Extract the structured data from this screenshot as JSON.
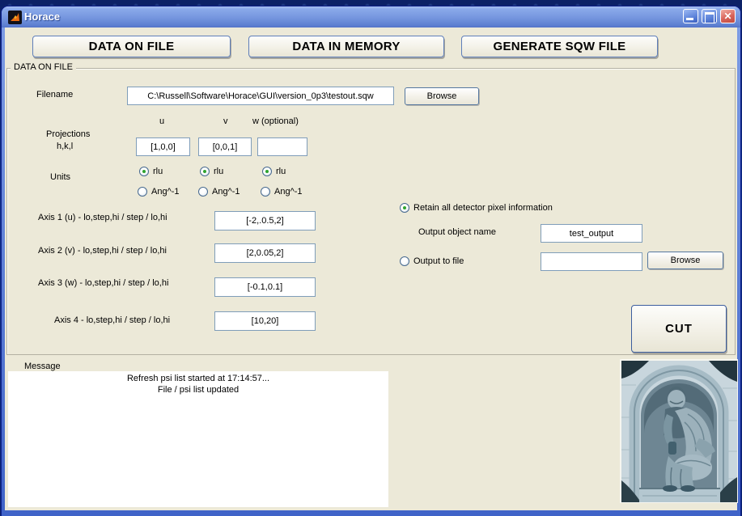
{
  "window": {
    "title": "Horace",
    "icons": {
      "matlab_logo": "matlab-membrane-logo",
      "minimize": "_",
      "maximize": "□",
      "close": "✕"
    }
  },
  "colors": {
    "desktop": "#0c2470",
    "titlebar_blue": "#7495de",
    "client_beige": "#ece9d8",
    "field_border": "#7f9db9",
    "radio_dot_green": "#2fa32f",
    "close_red": "#cf5a50"
  },
  "nav": {
    "data_on_file": "DATA ON FILE",
    "data_in_memory": "DATA IN MEMORY",
    "generate_sqw_file": "GENERATE SQW FILE"
  },
  "panel": {
    "title": "DATA ON FILE",
    "filename_label": "Filename",
    "filename_value": "C:\\Russell\\Software\\Horace\\GUI\\version_0p3\\testout.sqw",
    "browse_label": "Browse",
    "projections": {
      "col_u": "u",
      "col_v": "v",
      "col_w": "w (optional)",
      "label_line1": "Projections",
      "label_line2": "h,k,l",
      "u_value": "[1,0,0]",
      "v_value": "[0,0,1]",
      "w_value": ""
    },
    "units": {
      "label": "Units",
      "rlu_label": "rlu",
      "ang_label": "Ang^-1",
      "selected": "rlu"
    },
    "axes": [
      {
        "label": "Axis 1 (u) - lo,step,hi / step / lo,hi",
        "value": "[-2,.0.5,2]"
      },
      {
        "label": "Axis 2 (v) - lo,step,hi / step / lo,hi",
        "value": "[2,0.05,2]"
      },
      {
        "label": "Axis 3 (w) - lo,step,hi / step / lo,hi",
        "value": "[-0.1,0.1]"
      },
      {
        "label": "Axis 4 - lo,step,hi / step / lo,hi",
        "value": "[10,20]"
      }
    ],
    "output": {
      "retain_label": "Retain all detector pixel information",
      "object_name_label": "Output object name",
      "object_name_value": "test_output",
      "to_file_label": "Output to file",
      "to_file_value": "",
      "browse_label": "Browse",
      "selected": "retain"
    },
    "cut_label": "CUT"
  },
  "message": {
    "label": "Message",
    "lines": [
      "Refresh psi list started at 17:14:57...",
      "File / psi list updated"
    ]
  }
}
